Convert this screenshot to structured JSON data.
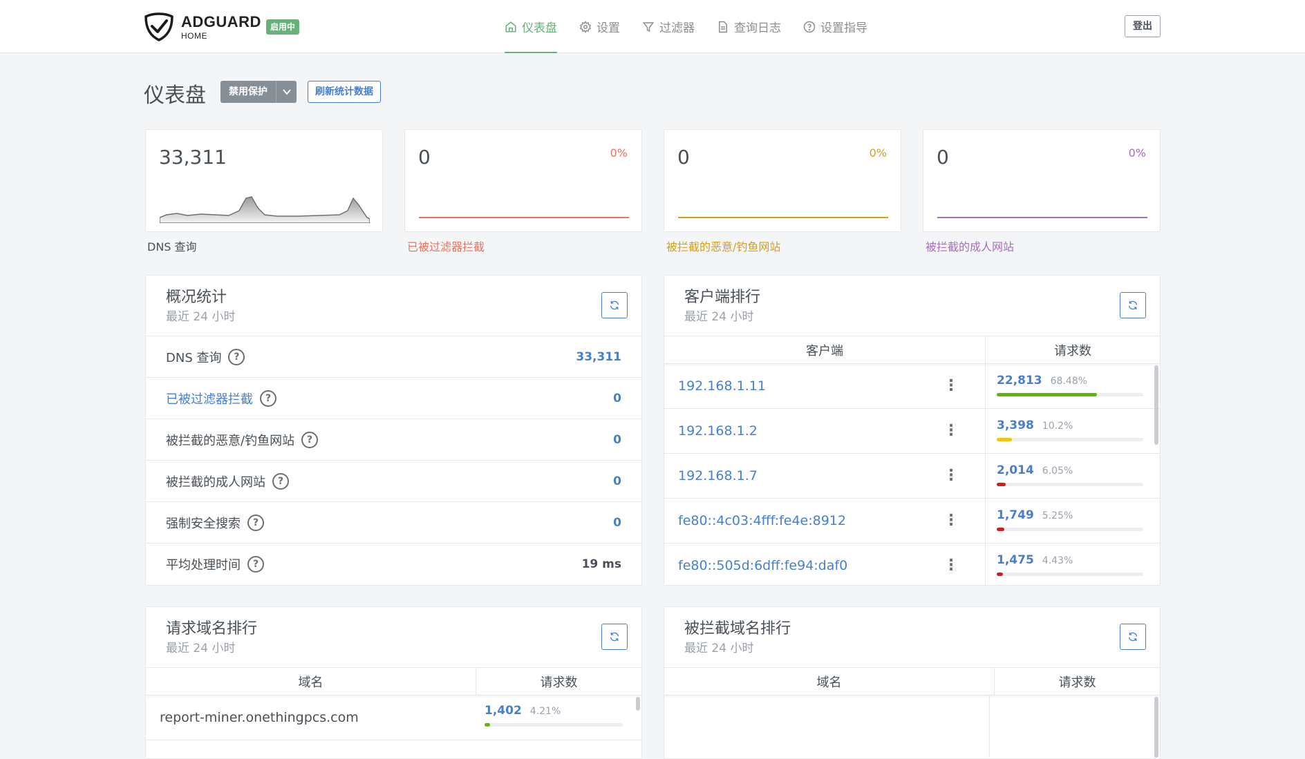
{
  "header": {
    "logo_text": "ADGUARD",
    "logo_sub": "HOME",
    "status_badge": "启用中",
    "nav": [
      {
        "label": "仪表盘",
        "icon": "home-icon",
        "active": true
      },
      {
        "label": "设置",
        "icon": "gear-icon",
        "active": false
      },
      {
        "label": "过滤器",
        "icon": "filter-icon",
        "active": false
      },
      {
        "label": "查询日志",
        "icon": "document-icon",
        "active": false
      },
      {
        "label": "设置指导",
        "icon": "help-circle-icon",
        "active": false
      }
    ],
    "logout_label": "登出"
  },
  "page": {
    "title": "仪表盘",
    "disable_label": "禁用保护",
    "refresh_label": "刷新统计数据"
  },
  "stat_cards": [
    {
      "value": "33,311",
      "pct": "",
      "label": "DNS 查询",
      "color": "#495057"
    },
    {
      "value": "0",
      "pct": "0%",
      "label": "已被过滤器拦截",
      "color": "#e8735e"
    },
    {
      "value": "0",
      "pct": "0%",
      "label": "被拦截的恶意/钓鱼网站",
      "color": "#d4a019"
    },
    {
      "value": "0",
      "pct": "0%",
      "label": "被拦截的成人网站",
      "color": "#a56fbe"
    }
  ],
  "overview": {
    "title": "概况统计",
    "subtitle": "最近 24 小时",
    "rows": [
      {
        "label": "DNS 查询",
        "value": "33,311"
      },
      {
        "label": "已被过滤器拦截",
        "value": "0"
      },
      {
        "label": "被拦截的恶意/钓鱼网站",
        "value": "0"
      },
      {
        "label": "被拦截的成人网站",
        "value": "0"
      },
      {
        "label": "强制安全搜索",
        "value": "0"
      },
      {
        "label": "平均处理时间",
        "value": "19 ms"
      }
    ]
  },
  "clients": {
    "title": "客户端排行",
    "subtitle": "最近 24 小时",
    "col_client": "客户端",
    "col_requests": "请求数",
    "rows": [
      {
        "client": "192.168.1.11",
        "count": "22,813",
        "pct": "68.48%",
        "fraction": 0.6848,
        "bar_color": "#5eba00"
      },
      {
        "client": "192.168.1.2",
        "count": "3,398",
        "pct": "10.2%",
        "fraction": 0.102,
        "bar_color": "#f1c40f"
      },
      {
        "client": "192.168.1.7",
        "count": "2,014",
        "pct": "6.05%",
        "fraction": 0.0605,
        "bar_color": "#cd201f"
      },
      {
        "client": "fe80::4c03:4fff:fe4e:8912",
        "count": "1,749",
        "pct": "5.25%",
        "fraction": 0.0525,
        "bar_color": "#cd201f"
      },
      {
        "client": "fe80::505d:6dff:fe94:daf0",
        "count": "1,475",
        "pct": "4.43%",
        "fraction": 0.0443,
        "bar_color": "#cd201f"
      }
    ]
  },
  "top_domains": {
    "title": "请求域名排行",
    "subtitle": "最近 24 小时",
    "col_domain": "域名",
    "col_requests": "请求数",
    "rows": [
      {
        "domain": "report-miner.onethingpcs.com",
        "count": "1,402",
        "pct": "4.21%",
        "fraction": 0.0421,
        "bar_color": "#5eba00"
      }
    ]
  },
  "blocked_domains": {
    "title": "被拦截域名排行",
    "subtitle": "最近 24 小时",
    "col_domain": "域名",
    "col_requests": "请求数"
  }
}
